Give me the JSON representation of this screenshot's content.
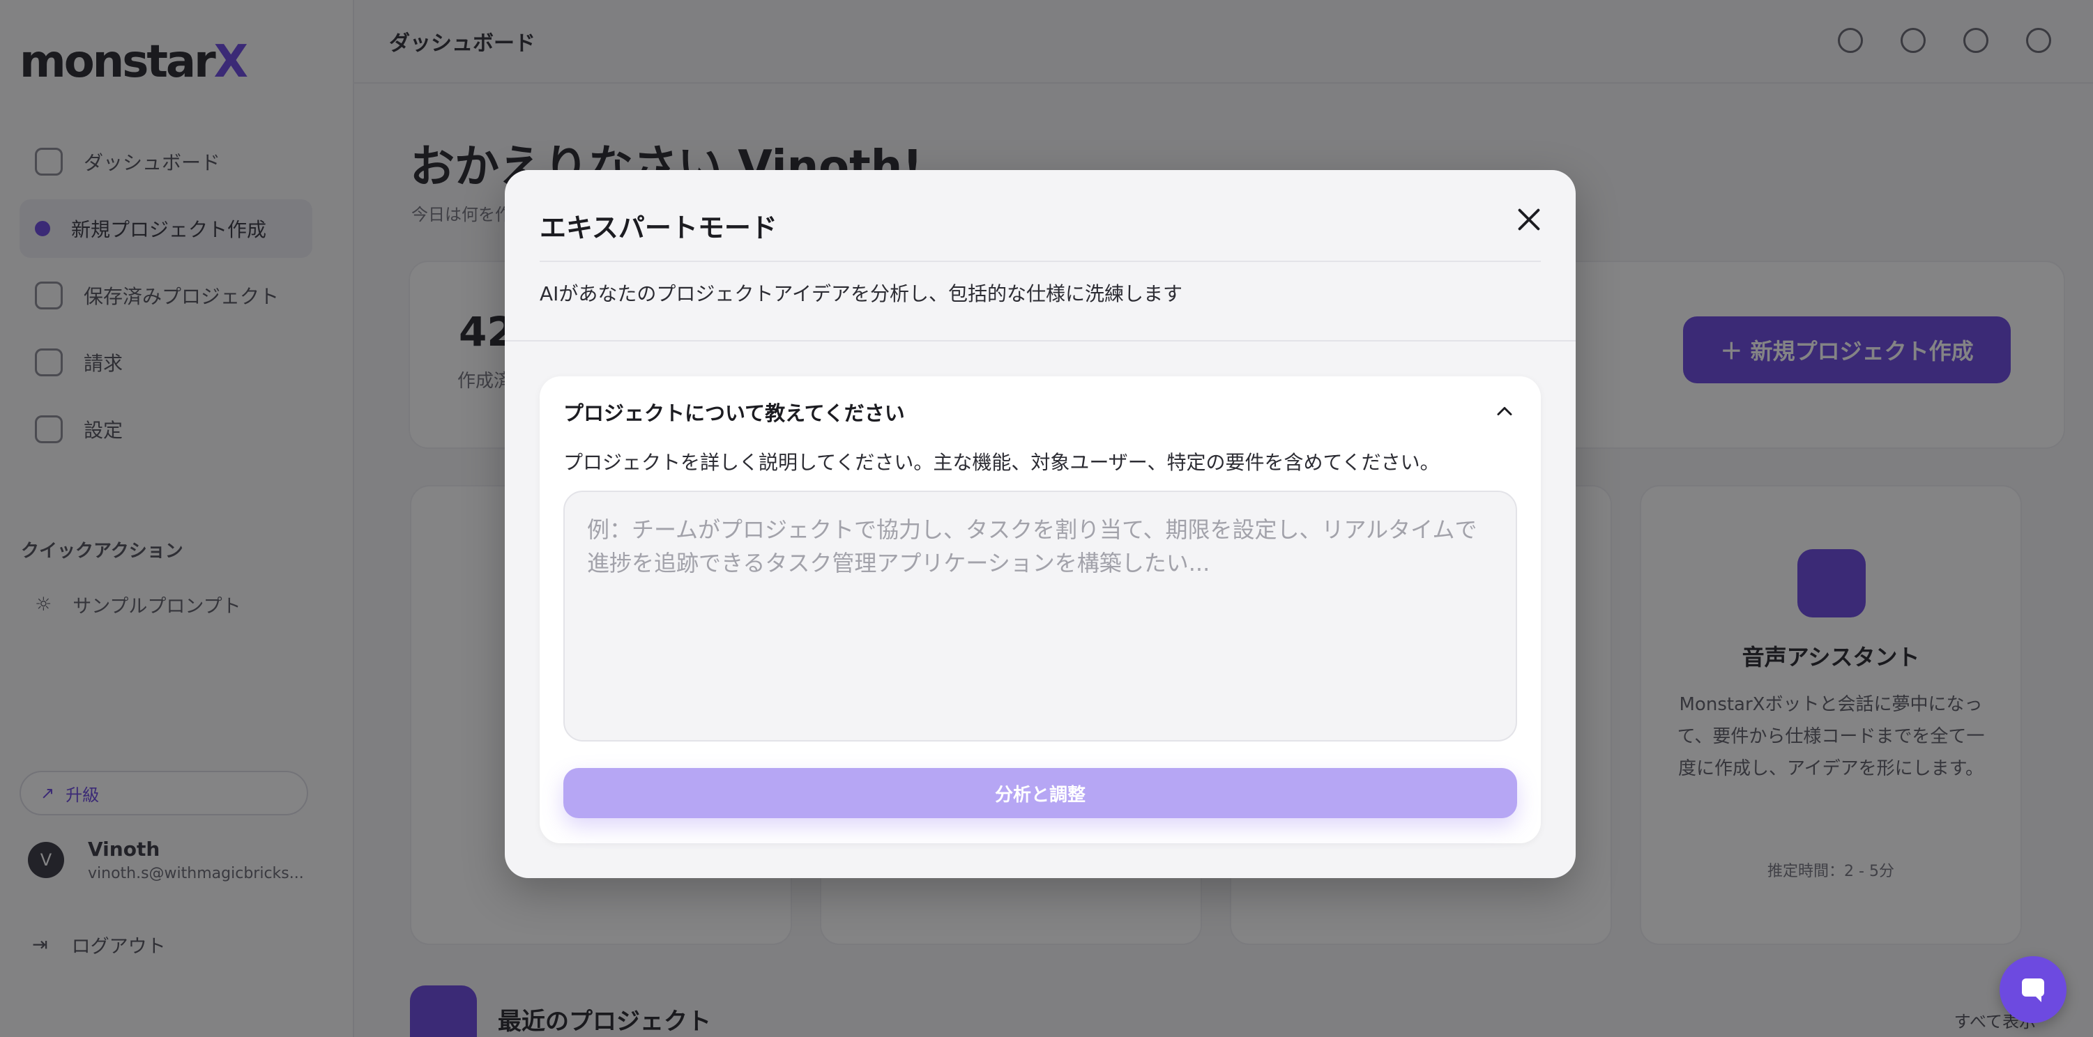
{
  "app": {
    "logo": "monstar",
    "logo_accent": "X",
    "topbar_title": "ダッシュボード"
  },
  "sidebar": {
    "items": [
      {
        "label": "ダッシュボード"
      },
      {
        "label": "新規プロジェクト作成"
      },
      {
        "label": "保存済みプロジェクト"
      },
      {
        "label": "請求"
      },
      {
        "label": "設定"
      }
    ],
    "quick_section": "クイックアクション",
    "quick_item": "サンプルプロンプト",
    "upgrade": "升級",
    "user_initial": "V",
    "user_name": "Vinoth",
    "user_email": "vinoth.s@withmagicbricks...",
    "logout": "ログアウト"
  },
  "main": {
    "welcome": "おかえりなさい Vinoth!",
    "welcome_sub": "今日は何を作りましょうか",
    "stat_value": "42",
    "stat_label": "作成済み",
    "new_project_button": "＋ 新規プロジェクト作成",
    "feature_title": "音声アシスタント",
    "feature_desc": "MonstarXボットと会話に夢中になって、要件から仕様コードまでを全て一度に作成し、アイデアを形にします。",
    "feature_footer": "推定時間：2 - 5分",
    "recent_title": "最近のプロジェクト",
    "view_all": "すべて表示"
  },
  "modal": {
    "title": "エキスパートモード",
    "subtitle": "AIがあなたのプロジェクトアイデアを分析し、包括的な仕様に洗練します",
    "panel_title": "プロジェクトについて教えてください",
    "panel_desc": "プロジェクトを詳しく説明してください。主な機能、対象ユーザー、特定の要件を含めてください。",
    "textarea_placeholder": "例：チームがプロジェクトで協力し、タスクを割り当て、期限を設定し、リアルタイムで進捗を追跡できるタスク管理アプリケーションを構築したい...",
    "textarea_value": "",
    "analyze_button": "分析と調整"
  },
  "colors": {
    "accent": "#6d4ae0",
    "button_disabled": "#b6a6f4"
  }
}
